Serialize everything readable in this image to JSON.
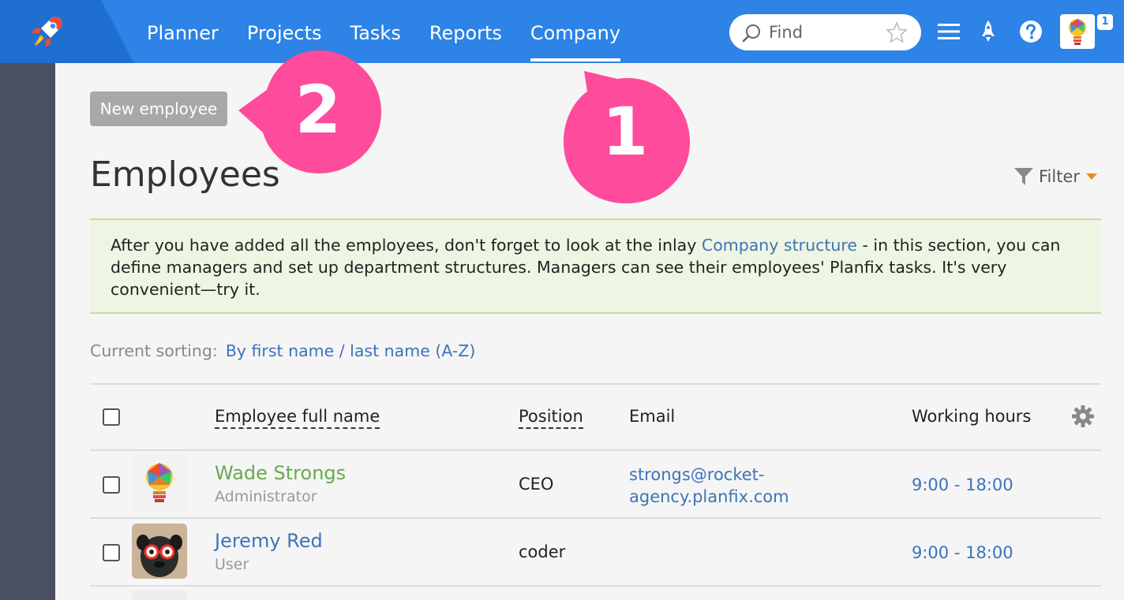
{
  "nav": {
    "items": [
      {
        "label": "Planner",
        "active": false
      },
      {
        "label": "Projects",
        "active": false
      },
      {
        "label": "Tasks",
        "active": false
      },
      {
        "label": "Reports",
        "active": false
      },
      {
        "label": "Company",
        "active": true
      }
    ]
  },
  "search": {
    "placeholder": "Find"
  },
  "top_icons": [
    "menu-icon",
    "rocket-icon",
    "help-icon"
  ],
  "notification_count": "1",
  "colors": {
    "topbar": "#2d83e6",
    "callout": "#ff4b9c",
    "accent_green": "#6aa84f",
    "link": "#3c74b8"
  },
  "toolbar": {
    "new_employee": "New employee"
  },
  "page": {
    "title": "Employees",
    "filter_label": "Filter"
  },
  "info": {
    "before": "After you have added all the employees, don't forget to look at the inlay ",
    "link": "Company structure",
    "after": " - in this section, you can define managers and set up department structures. Managers can see their employees' Planfix tasks. It's very convenient—try it."
  },
  "sorting": {
    "label": "Current sorting:",
    "value": "By first name / last name (A-Z)"
  },
  "table": {
    "headers": {
      "name": "Employee full name",
      "position": "Position",
      "email": "Email",
      "hours": "Working hours"
    },
    "rows": [
      {
        "name": "Wade Strongs",
        "role": "Administrator",
        "position": "CEO",
        "email_line1": "strongs@rocket-",
        "email_line2": "agency.planfix.com",
        "hours": "9:00 - 18:00"
      },
      {
        "name": "Jeremy Red",
        "role": "User",
        "position": "coder",
        "email_line1": "",
        "email_line2": "",
        "hours": "9:00 - 18:00"
      }
    ]
  },
  "callouts": [
    {
      "label": "1"
    },
    {
      "label": "2"
    }
  ]
}
